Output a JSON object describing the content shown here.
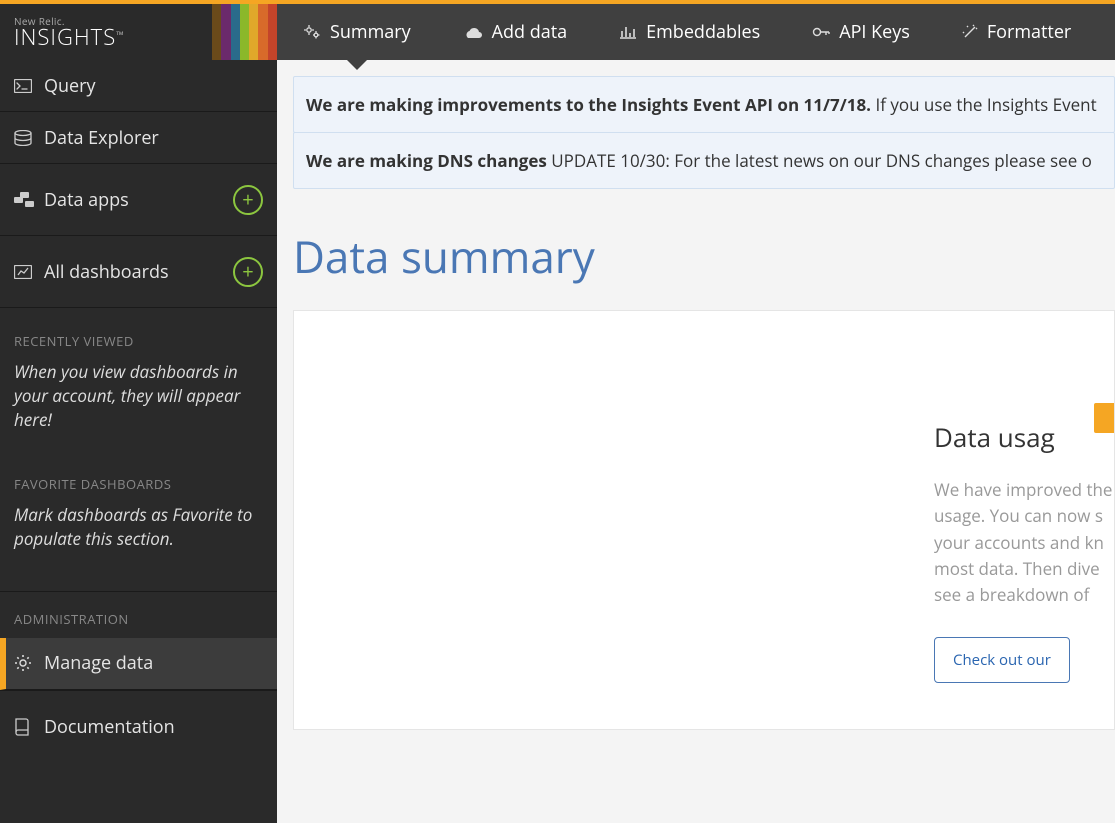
{
  "brand": {
    "small": "New Relic.",
    "big": "INSIGHTS"
  },
  "sidebar": {
    "query": "Query",
    "explorer": "Data Explorer",
    "apps": "Data apps",
    "dashboards": "All dashboards",
    "recently_header": "RECENTLY VIEWED",
    "recently_text": "When you view dashboards in your account, they will appear here!",
    "fav_header": "FAVORITE DASHBOARDS",
    "fav_text": "Mark dashboards as Favorite to populate this section.",
    "admin_header": "ADMINISTRATION",
    "manage": "Manage data",
    "docs": "Documentation"
  },
  "tabs": {
    "summary": "Summary",
    "add": "Add data",
    "embed": "Embeddables",
    "keys": "API Keys",
    "formatter": "Formatter"
  },
  "alerts": {
    "a1_bold": "We are making improvements to the Insights Event API on 11/7/18.",
    "a1_rest": " If you use the Insights Event",
    "a2_bold": "We are making DNS changes",
    "a2_rest": " UPDATE 10/30: For the latest news on our DNS changes please see o"
  },
  "page": {
    "title": "Data summary"
  },
  "card": {
    "title": "Data usag",
    "line1": "We have improved the",
    "line2": "usage. You can now s",
    "line3": "your accounts and kn",
    "line4": "most data. Then dive ",
    "line5": "see a breakdown of",
    "button": "Check out our "
  }
}
